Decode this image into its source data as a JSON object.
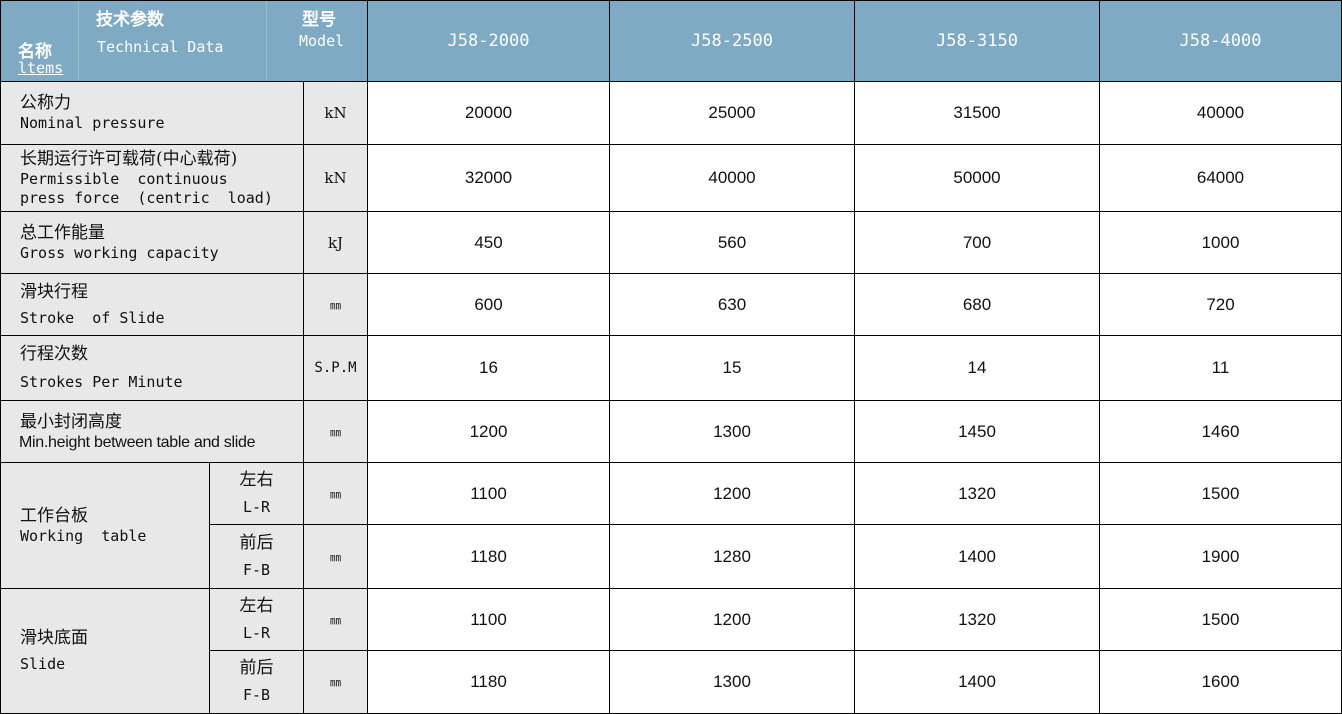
{
  "header": {
    "items_zh": "名称",
    "items_en": "ltems",
    "tech_zh": "技术参数",
    "tech_en": "Technical Data",
    "model_zh": "型号",
    "model_en": "Model",
    "models": [
      "J58-2000",
      "J58-2500",
      "J58-3150",
      "J58-4000"
    ]
  },
  "rows": [
    {
      "zh": "公称力",
      "en": "Nominal pressure",
      "unit": "kN",
      "values": [
        "20000",
        "25000",
        "31500",
        "40000"
      ]
    },
    {
      "zh": "长期运行许可载荷(中心载荷)",
      "en1": "Permissible  continuous",
      "en2": "press force  (centric  load)",
      "unit": "kN",
      "values": [
        "32000",
        "40000",
        "50000",
        "64000"
      ]
    },
    {
      "zh": "总工作能量",
      "en": "Gross working capacity",
      "unit": "kJ",
      "values": [
        "450",
        "560",
        "700",
        "1000"
      ]
    },
    {
      "zh": "滑块行程",
      "en": "Stroke  of Slide",
      "unit": "㎜",
      "values": [
        "600",
        "630",
        "680",
        "720"
      ]
    },
    {
      "zh": "行程次数",
      "en": "Strokes Per Minute",
      "unit": "S.P.M",
      "values": [
        "16",
        "15",
        "14",
        "11"
      ]
    },
    {
      "zh": "最小封闭高度",
      "en": "Min.height between table and slide",
      "unit": "㎜",
      "values": [
        "1200",
        "1300",
        "1450",
        "1460"
      ]
    }
  ],
  "groups": [
    {
      "zh": "工作台板",
      "en": "Working  table",
      "subs": [
        {
          "zh": "左右",
          "en": "L-R",
          "unit": "㎜",
          "values": [
            "1100",
            "1200",
            "1320",
            "1500"
          ]
        },
        {
          "zh": "前后",
          "en": "F-B",
          "unit": "㎜",
          "values": [
            "1180",
            "1280",
            "1400",
            "1900"
          ]
        }
      ]
    },
    {
      "zh": "滑块底面",
      "en": "Slide",
      "subs": [
        {
          "zh": "左右",
          "en": "L-R",
          "unit": "㎜",
          "values": [
            "1100",
            "1200",
            "1320",
            "1500"
          ]
        },
        {
          "zh": "前后",
          "en": "F-B",
          "unit": "㎜",
          "values": [
            "1180",
            "1300",
            "1400",
            "1600"
          ]
        }
      ]
    }
  ]
}
